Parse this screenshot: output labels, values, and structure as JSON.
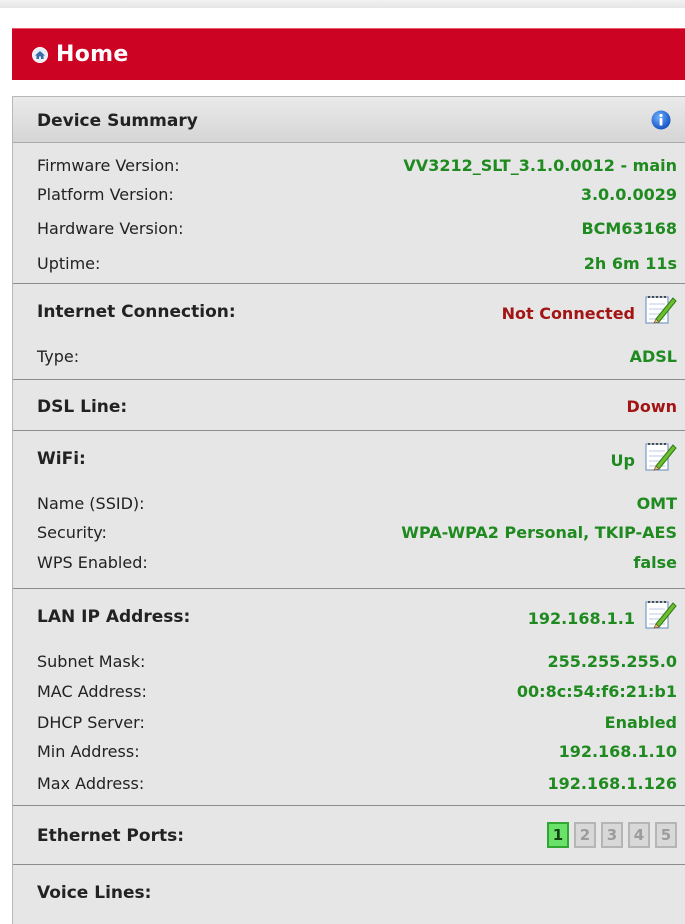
{
  "header": {
    "title": "Home",
    "icon": "home-icon",
    "bg_color": "#cc0322"
  },
  "summary": {
    "title": "Device Summary",
    "info_icon": "info-icon",
    "rows": [
      {
        "label": "Firmware Version:",
        "value": "VV3212_SLT_3.1.0.0012 - main"
      },
      {
        "label": "Platform Version:",
        "value": "3.0.0.0029"
      },
      {
        "label": "Hardware Version:",
        "value": "BCM63168"
      },
      {
        "label": "Uptime:",
        "value": "2h 6m 11s"
      }
    ]
  },
  "internet": {
    "label": "Internet Connection:",
    "value": "Not Connected",
    "type_label": "Type:",
    "type_value": "ADSL"
  },
  "dsl": {
    "label": "DSL Line:",
    "value": "Down"
  },
  "wifi": {
    "label": "WiFi:",
    "value": "Up",
    "rows": [
      {
        "label": "Name (SSID):",
        "value": "OMT"
      },
      {
        "label": "Security:",
        "value": "WPA-WPA2 Personal, TKIP-AES"
      },
      {
        "label": "WPS Enabled:",
        "value": "false"
      }
    ]
  },
  "lan": {
    "label": "LAN IP Address:",
    "value": "192.168.1.1",
    "rows": [
      {
        "label": "Subnet Mask:",
        "value": "255.255.255.0"
      },
      {
        "label": "MAC Address:",
        "value": "00:8c:54:f6:21:b1"
      },
      {
        "label": "DHCP Server:",
        "value": "Enabled"
      },
      {
        "label": "Min Address:",
        "value": "192.168.1.10"
      },
      {
        "label": "Max Address:",
        "value": "192.168.1.126"
      }
    ]
  },
  "ethernet": {
    "label": "Ethernet Ports:",
    "ports": [
      {
        "number": "1",
        "active": true
      },
      {
        "number": "2",
        "active": false
      },
      {
        "number": "3",
        "active": false
      },
      {
        "number": "4",
        "active": false
      },
      {
        "number": "5",
        "active": false
      }
    ]
  },
  "voice": {
    "label": "Voice Lines:"
  },
  "colors": {
    "ok": "#1f8a1f",
    "error": "#a31414",
    "port_active": "#6ae26a"
  }
}
